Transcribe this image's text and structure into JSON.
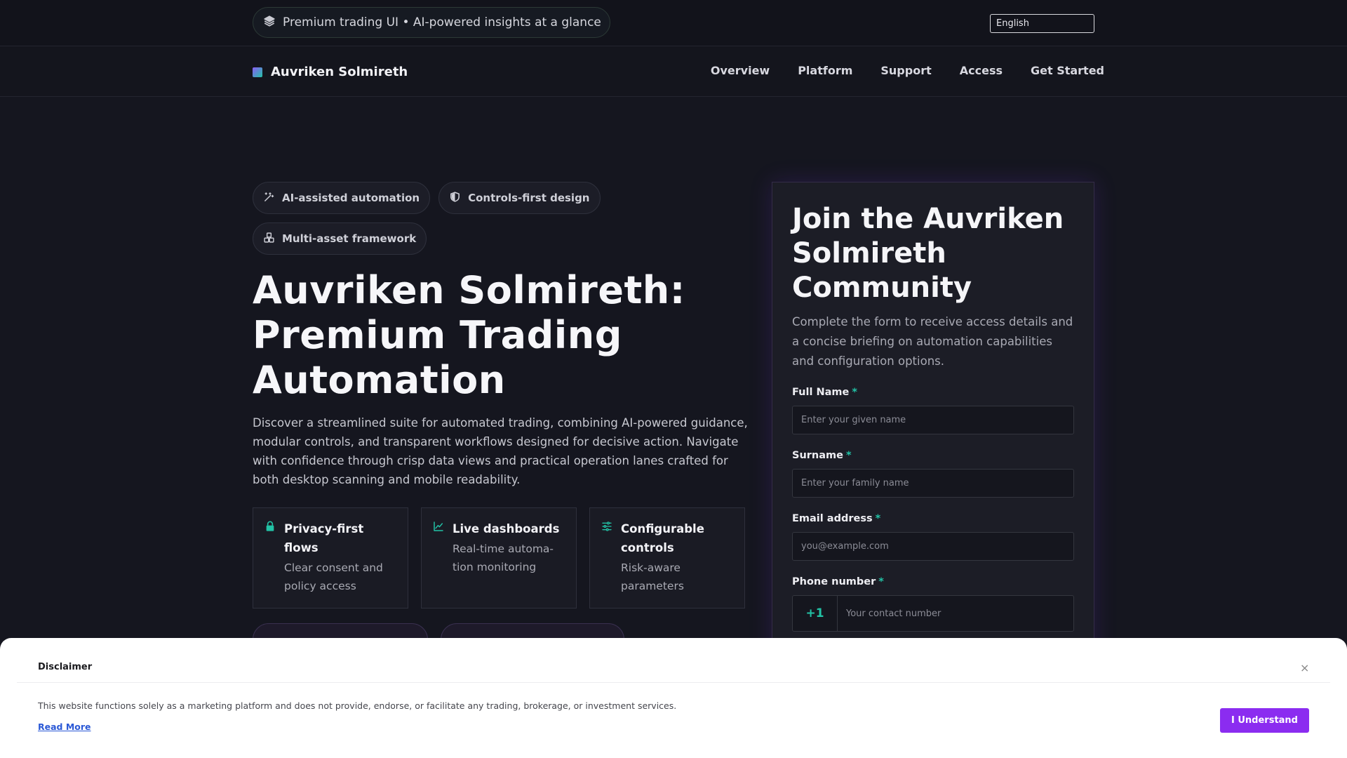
{
  "topbar": {
    "promo_text": "Premium trading UI • AI-powered insights at a glance",
    "language": "English"
  },
  "nav": {
    "brand": "Auvriken Solmireth",
    "links": [
      "Overview",
      "Platform",
      "Support",
      "Access",
      "Get Started"
    ]
  },
  "hero": {
    "chips": [
      {
        "label": "AI-assisted automation",
        "icon": "magic-wand-icon"
      },
      {
        "label": "Controls-first design",
        "icon": "shield-icon"
      },
      {
        "label": "Multi-asset framework",
        "icon": "cubes-icon"
      }
    ],
    "title": "Auvriken Solmireth: Premium Trading Automation",
    "description": "Discover a streamlined suite for automated trading, combining AI-powered guidance, modular controls, and transparent workflows designed for decisive action. Navigate with confidence through crisp data views and practical operation lanes crafted for both desktop scanning and mobile readability.",
    "features": [
      {
        "title": "Privacy-first flows",
        "subtitle": "Clear consent and policy access",
        "icon": "lock-icon"
      },
      {
        "title": "Live dashboards",
        "subtitle": "Real-time automa-tion monitoring",
        "icon": "line-chart-icon"
      },
      {
        "title": "Configurable controls",
        "subtitle": "Risk-aware parameters",
        "icon": "sliders-icon"
      }
    ]
  },
  "form": {
    "title": "Join the Auvriken Solmireth Community",
    "subtitle": "Complete the form to receive access details and a concise briefing on automation capabilities and configuration options.",
    "required_mark": "*",
    "fields": {
      "full_name": {
        "label": "Full Name",
        "placeholder": "Enter your given name"
      },
      "surname": {
        "label": "Surname",
        "placeholder": "Enter your family name"
      },
      "email": {
        "label": "Email address",
        "placeholder": "you@example.com"
      },
      "phone": {
        "label": "Phone number",
        "code": "+1",
        "placeholder": "Your contact number"
      }
    }
  },
  "disclaimer": {
    "title": "Disclaimer",
    "close": "×",
    "text": "This website functions solely as a marketing platform and does not provide, endorse, or facilitate any trading, brokerage, or investment services.",
    "link": "Read More",
    "button": "I Understand"
  },
  "colors": {
    "accent_green": "#22c3a6",
    "accent_purple": "#8b2cf0",
    "background": "#15161f"
  }
}
